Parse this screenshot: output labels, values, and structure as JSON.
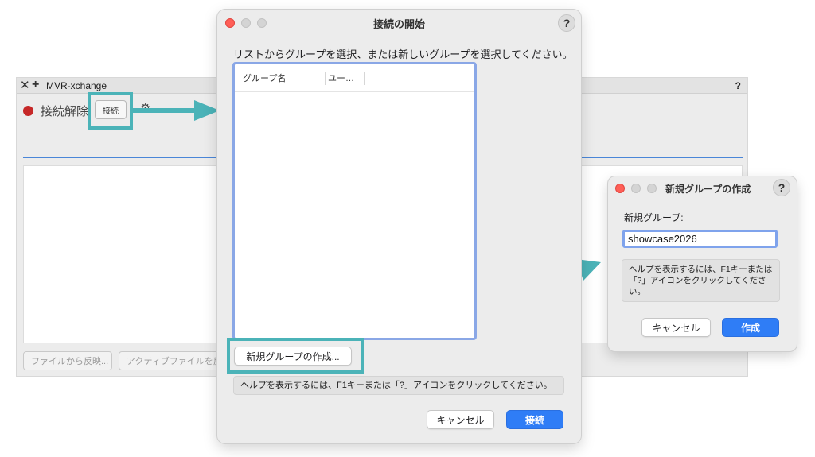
{
  "palette": {
    "title": "MVR-xchange",
    "help": "?",
    "status_text": "接続解除",
    "connect_button": "接続",
    "buttons": [
      "ファイルから反映...",
      "アクティブファイルを反"
    ]
  },
  "main_dialog": {
    "title": "接続の開始",
    "help": "?",
    "instruction": "リストからグループを選択、または新しいグループを選択してください。",
    "columns": [
      "グループ名",
      "ユー…"
    ],
    "new_group_button": "新規グループの作成...",
    "help_text": "ヘルプを表示するには、F1キーまたは「?」アイコンをクリックしてください。",
    "cancel_button": "キャンセル",
    "connect_button": "接続"
  },
  "new_group_dialog": {
    "title": "新規グループの作成",
    "help": "?",
    "label": "新規グループ:",
    "input_value": "showcase2026",
    "help_text": "ヘルプを表示するには、F1キーまたは「?」アイコンをクリックしてください。",
    "cancel_button": "キャンセル",
    "create_button": "作成"
  },
  "colors": {
    "highlight": "#4bb3b8",
    "accent_blue": "#2f7df6",
    "status_red": "#c62828"
  }
}
